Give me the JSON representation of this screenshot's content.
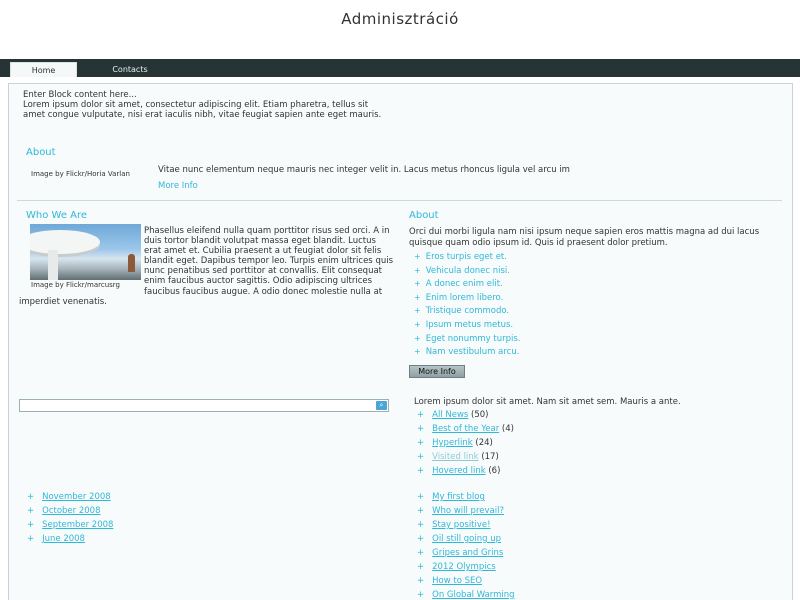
{
  "site": {
    "title": "Adminisztráció"
  },
  "nav": {
    "tabs": [
      {
        "label": "Home"
      },
      {
        "label": "Contacts"
      }
    ]
  },
  "intro": {
    "line1": "Enter Block content here...",
    "text": "Lorem ipsum dolor sit amet, consectetur adipiscing elit. Etiam pharetra, tellus sit amet congue vulputate, nisi erat iaculis nibh, vitae feugiat sapien ante eget mauris."
  },
  "about1": {
    "heading": "About",
    "caption": "Image by Flickr/Horia Varlan",
    "text": "Vitae nunc elementum neque mauris nec integer velit in. Lacus metus rhoncus ligula vel arcu im",
    "more": "More Info"
  },
  "who": {
    "heading": "Who We Are",
    "caption": "Image by Flickr/marcusrg",
    "text": "Phasellus eleifend nulla quam porttitor risus sed orci. A in duis tortor blandit volutpat massa eget blandit. Luctus erat amet et. Cubilia praesent a ut feugiat dolor sit felis blandit eget. Dapibus tempor leo. Turpis enim ultrices quis nunc penatibus sed porttitor at convallis. Elit consequat enim faucibus auctor sagittis. Odio adipiscing ultrices faucibus faucibus augue. A odio donec molestie nulla at imperdiet venenatis."
  },
  "about2": {
    "heading": "About",
    "text": "Orci dui morbi ligula nam nisi ipsum neque sapien eros mattis magna ad dui lacus quisque quam odio ipsum id. Quis id praesent dolor pretium.",
    "items": [
      "Eros turpis eget et.",
      "Vehicula donec nisi.",
      "A donec enim elit.",
      "Enim lorem libero.",
      "Tristique commodo.",
      "Ipsum metus metus.",
      "Eget nonummy turpis.",
      "Nam vestibulum arcu."
    ],
    "button": "More Info"
  },
  "search": {
    "value": "",
    "icon": "search-icon"
  },
  "categories": {
    "intro": "Lorem ipsum dolor sit amet. Nam sit amet sem. Mauris a ante.",
    "items": [
      {
        "label": "All News",
        "count": "(50)"
      },
      {
        "label": "Best of the Year",
        "count": "(4)"
      },
      {
        "label": "Hyperlink",
        "count": "(24)"
      },
      {
        "label": "Visited link",
        "count": "(17)"
      },
      {
        "label": "Hovered link",
        "count": "(6)"
      }
    ]
  },
  "archives": [
    "November 2008",
    "October 2008",
    "September 2008",
    "June 2008"
  ],
  "blog": [
    "My first blog",
    "Who will prevail?",
    "Stay positive!",
    "Oil still going up",
    "Gripes and Grins",
    "2012 Olympics",
    "How to SEO",
    "On Global Warming"
  ],
  "colors": {
    "accent": "#2fb8d8",
    "navbar": "#263436",
    "panel": "#f8fbfb"
  }
}
